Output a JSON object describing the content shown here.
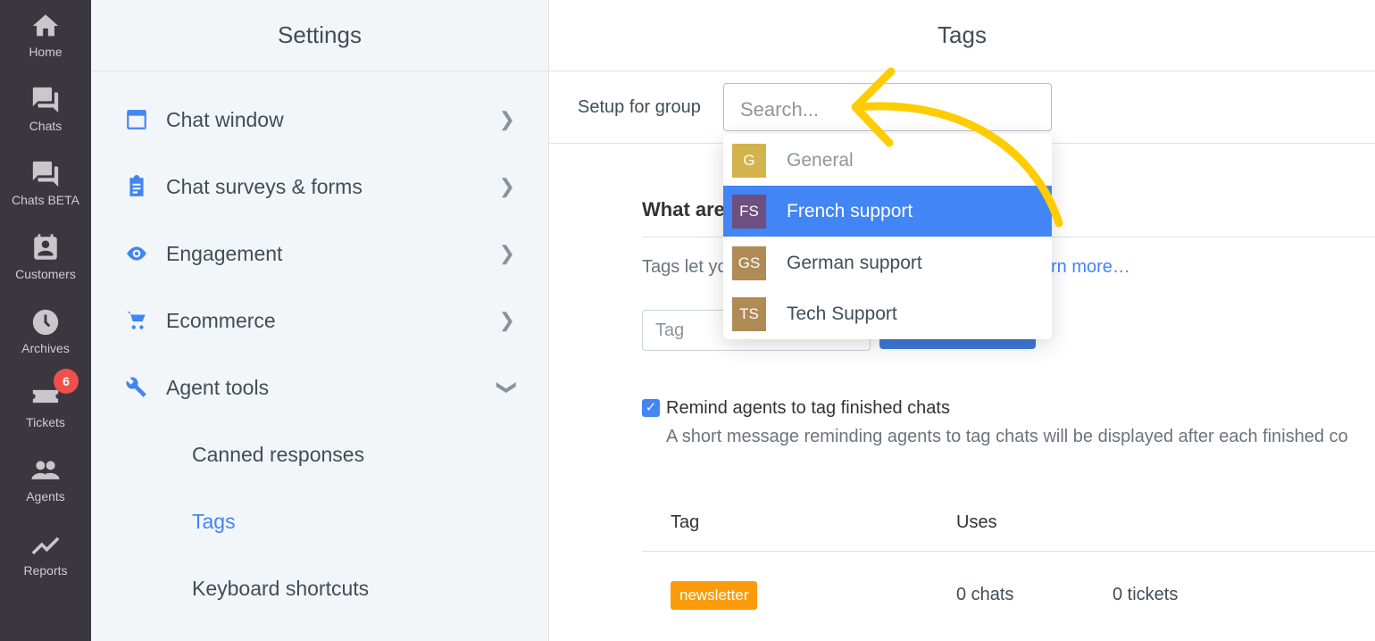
{
  "nav": {
    "items": [
      {
        "label": "Home",
        "icon": "home-icon"
      },
      {
        "label": "Chats",
        "icon": "chats-icon"
      },
      {
        "label": "Chats BETA",
        "icon": "chats-beta-icon"
      },
      {
        "label": "Customers",
        "icon": "customers-icon"
      },
      {
        "label": "Archives",
        "icon": "clock-icon"
      },
      {
        "label": "Tickets",
        "icon": "ticket-icon",
        "badge": "6"
      },
      {
        "label": "Agents",
        "icon": "agents-icon"
      },
      {
        "label": "Reports",
        "icon": "reports-icon"
      }
    ]
  },
  "settings": {
    "title": "Settings",
    "items": [
      {
        "label": "Chat window",
        "icon": "window-icon"
      },
      {
        "label": "Chat surveys & forms",
        "icon": "clipboard-icon"
      },
      {
        "label": "Engagement",
        "icon": "eye-icon"
      },
      {
        "label": "Ecommerce",
        "icon": "cart-icon"
      },
      {
        "label": "Agent tools",
        "icon": "wrench-icon",
        "expanded": true
      }
    ],
    "subitems": [
      {
        "label": "Canned responses"
      },
      {
        "label": "Tags",
        "active": true
      },
      {
        "label": "Keyboard shortcuts"
      }
    ]
  },
  "main": {
    "title": "Tags",
    "group_label": "Setup for group",
    "search_placeholder": "Search...",
    "heading_visible": "What are",
    "desc_visible": "Tags let yo",
    "learn_more_visible": "rn more…",
    "tag_placeholder": "Tag",
    "remind_label": "Remind agents to tag finished chats",
    "remind_checked": true,
    "remind_desc": "A short message reminding agents to tag chats will be displayed after each finished co",
    "table": {
      "headers": [
        "Tag",
        "Uses"
      ],
      "rows": [
        {
          "tag": "newsletter",
          "chats": "0 chats",
          "tickets": "0 tickets"
        }
      ]
    }
  },
  "dropdown": {
    "options": [
      {
        "initials": "G",
        "label": "General",
        "color": "#d4b24c",
        "muted": true
      },
      {
        "initials": "FS",
        "label": "French support",
        "color": "#6e4f7f",
        "selected": true
      },
      {
        "initials": "GS",
        "label": "German support",
        "color": "#b08b55"
      },
      {
        "initials": "TS",
        "label": "Tech Support",
        "color": "#b08b55"
      }
    ]
  },
  "colors": {
    "accent": "#4285f4",
    "nav_bg": "#3a373f",
    "tag_badge": "#fb9b0a",
    "annotation_arrow": "#ffcc00"
  }
}
